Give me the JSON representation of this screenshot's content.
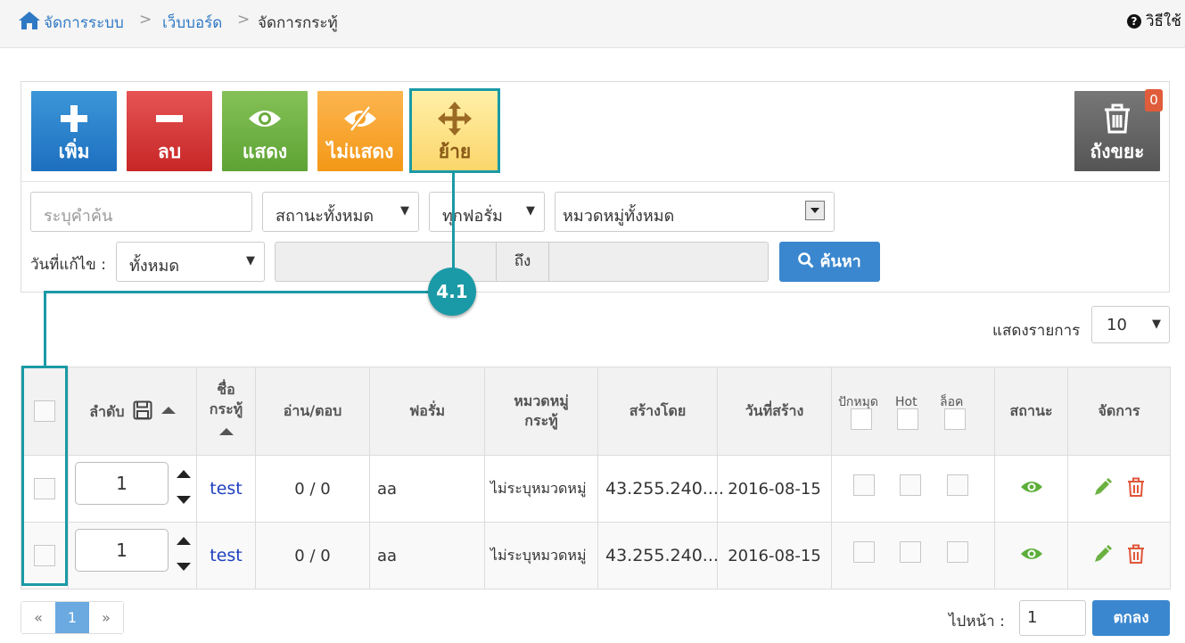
{
  "breadcrumb": {
    "home": "จัดการระบบ",
    "level2": "เว็บบอร์ด",
    "current": "จัดการกระทู้",
    "separator": ">"
  },
  "help_label": "วิธีใช้",
  "help_icon": "question-circle-icon",
  "toolbar": {
    "add": "เพิ่ม",
    "delete": "ลบ",
    "show": "แสดง",
    "hide": "ไม่แสดง",
    "move": "ย้าย",
    "trash": "ถังขยะ",
    "trash_count": "0"
  },
  "callout": {
    "label": "4.1",
    "color": "#1a9aa6"
  },
  "filters": {
    "search_placeholder": "ระบุคำค้น",
    "status": "สถานะทั้งหมด",
    "forum": "ทุกฟอรั่ม",
    "category": "หมวดหมู่ทั้งหมด",
    "date_label": "วันที่แก้ไข :",
    "date_option": "ทั้งหมด",
    "range_to": "ถึง",
    "search_button": "ค้นหา"
  },
  "per_page": {
    "label": "แสดงรายการ",
    "value": "10"
  },
  "table": {
    "headers": {
      "order": "ลำดับ",
      "name_line1": "ชื่อ",
      "name_line2": "กระทู้",
      "read_reply": "อ่าน/ตอบ",
      "forum": "ฟอรั่ม",
      "category_line1": "หมวดหมู่",
      "category_line2": "กระทู้",
      "created_by": "สร้างโดย",
      "created_date": "วันที่สร้าง",
      "pin": "ปักหมุด",
      "hot": "Hot",
      "lock": "ล็อค",
      "status": "สถานะ",
      "manage": "จัดการ"
    },
    "rows": [
      {
        "order": "1",
        "name": "test",
        "read_reply": "0 / 0",
        "forum": "aa",
        "category": "ไม่ระบุหมวดหมู่",
        "created_by": "43.255.240....",
        "created_date": "2016-08-15"
      },
      {
        "order": "1",
        "name": "test",
        "read_reply": "0 / 0",
        "forum": "aa",
        "category": "ไม่ระบุหมวดหมู่",
        "created_by": "43.255.240....",
        "created_date": "2016-08-15"
      }
    ]
  },
  "pagination": {
    "prev": "«",
    "current": "1",
    "next": "»"
  },
  "goto": {
    "label": "ไปหน้า :",
    "value": "1",
    "button": "ตกลง"
  },
  "colors": {
    "add": "#2a82cc",
    "delete": "#d73a3a",
    "show": "#72b346",
    "hide": "#f8a42f",
    "move": "#fde38a",
    "trash": "#666666",
    "link": "#2f79c4",
    "primary": "#3a87cf"
  }
}
